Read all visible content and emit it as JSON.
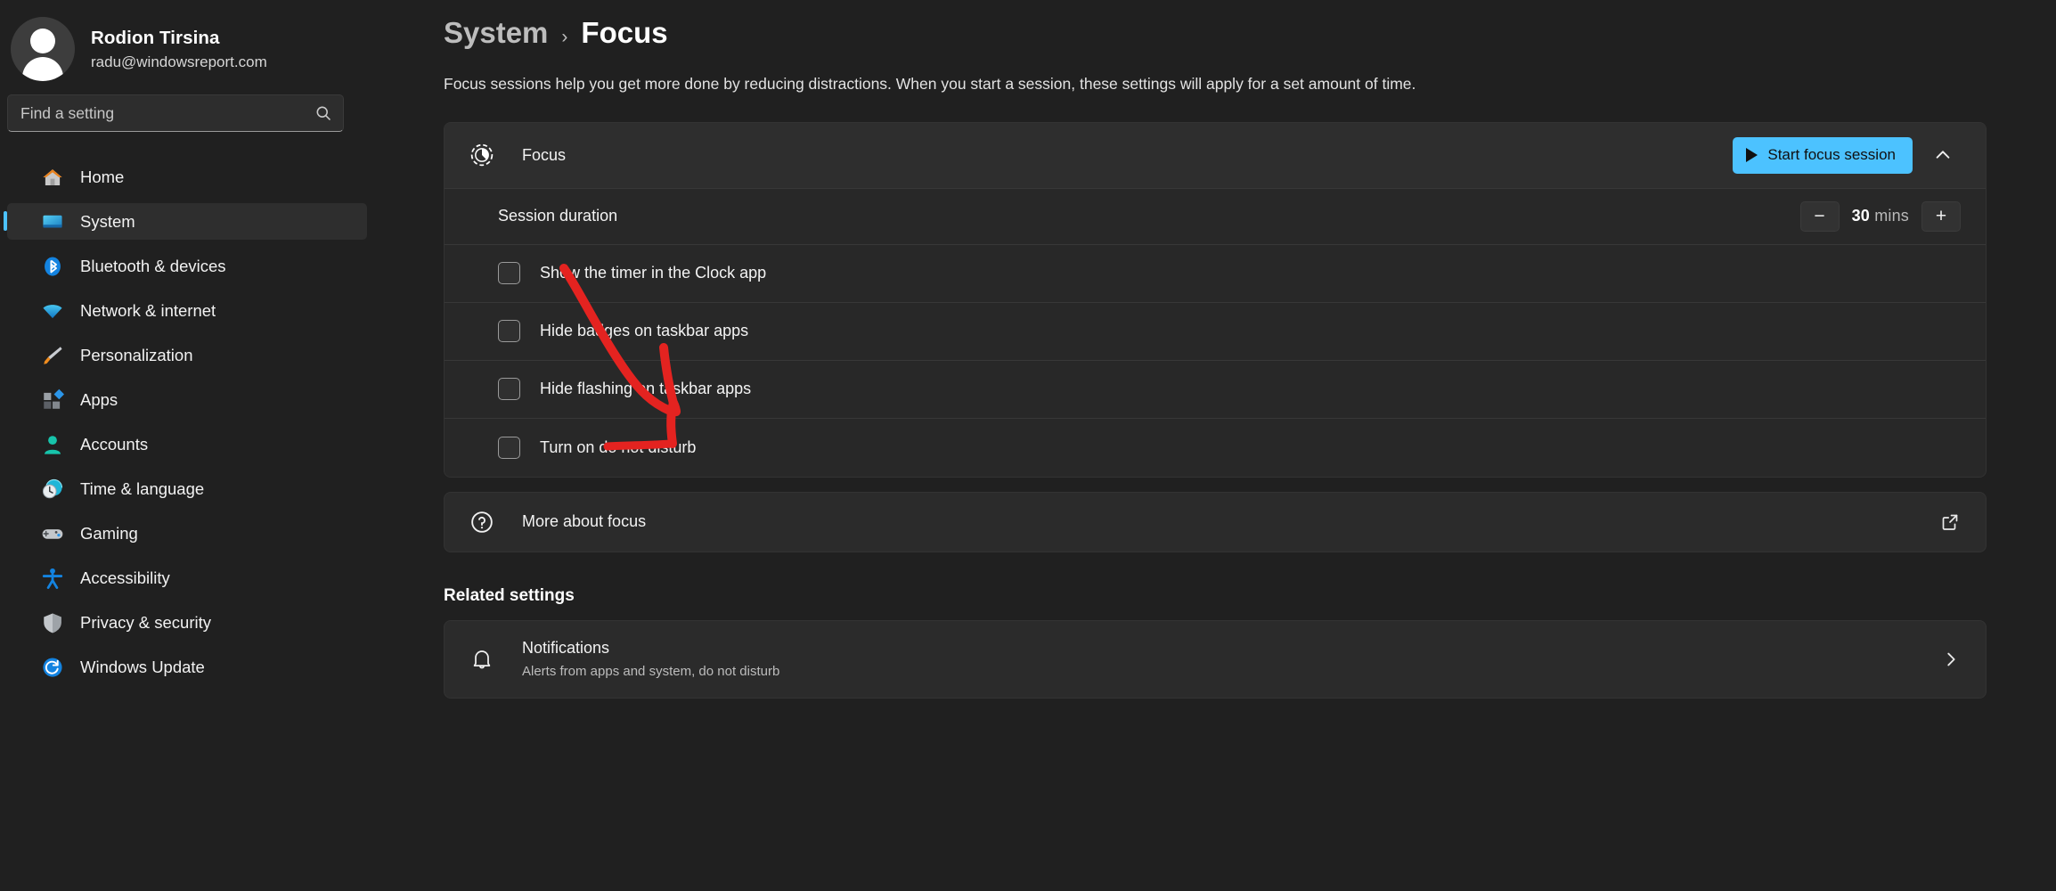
{
  "account": {
    "name": "Rodion Tirsina",
    "email": "radu@windowsreport.com",
    "avatar_icon": "user-avatar"
  },
  "search": {
    "placeholder": "Find a setting",
    "value": "",
    "icon": "search-icon"
  },
  "sidebar": {
    "items": [
      {
        "label": "Home",
        "icon": "home-icon",
        "selected": false
      },
      {
        "label": "System",
        "icon": "system-monitor-icon",
        "selected": true
      },
      {
        "label": "Bluetooth & devices",
        "icon": "bluetooth-icon",
        "selected": false
      },
      {
        "label": "Network & internet",
        "icon": "wifi-icon",
        "selected": false
      },
      {
        "label": "Personalization",
        "icon": "paintbrush-icon",
        "selected": false
      },
      {
        "label": "Apps",
        "icon": "apps-icon",
        "selected": false
      },
      {
        "label": "Accounts",
        "icon": "person-icon",
        "selected": false
      },
      {
        "label": "Time & language",
        "icon": "clock-globe-icon",
        "selected": false
      },
      {
        "label": "Gaming",
        "icon": "gamepad-icon",
        "selected": false
      },
      {
        "label": "Accessibility",
        "icon": "accessibility-icon",
        "selected": false
      },
      {
        "label": "Privacy & security",
        "icon": "shield-icon",
        "selected": false
      },
      {
        "label": "Windows Update",
        "icon": "update-refresh-icon",
        "selected": false
      }
    ]
  },
  "breadcrumb": {
    "parent": "System",
    "separator": "›",
    "current": "Focus"
  },
  "page": {
    "intro": "Focus sessions help you get more done by reducing distractions. When you start a session, these settings will apply for a set amount of time."
  },
  "focus_card": {
    "icon": "focus-timer-icon",
    "title": "Focus",
    "start_button": {
      "label": "Start focus session",
      "icon": "play-icon",
      "accent_color": "#4cc2ff",
      "text_color": "#101010"
    },
    "expand_chevron": "chevron-up-icon",
    "session_duration": {
      "label": "Session duration",
      "decrement": "−",
      "increment": "+",
      "value": "30",
      "unit": "mins"
    },
    "options": [
      {
        "label": "Show the timer in the Clock app",
        "checked": false
      },
      {
        "label": "Hide badges on taskbar apps",
        "checked": false
      },
      {
        "label": "Hide flashing on taskbar apps",
        "checked": false
      },
      {
        "label": "Turn on do not disturb",
        "checked": false
      }
    ]
  },
  "more_card": {
    "icon": "question-circle-icon",
    "label": "More about focus",
    "action_icon": "external-link-icon"
  },
  "related": {
    "heading": "Related settings",
    "items": [
      {
        "icon": "bell-icon",
        "title": "Notifications",
        "subtitle": "Alerts from apps and system, do not disturb",
        "action_icon": "chevron-right-icon"
      }
    ]
  },
  "annotation": {
    "type": "hand-drawn-arrow",
    "color": "#e42320",
    "points_to": "Hide badges on taskbar apps"
  }
}
